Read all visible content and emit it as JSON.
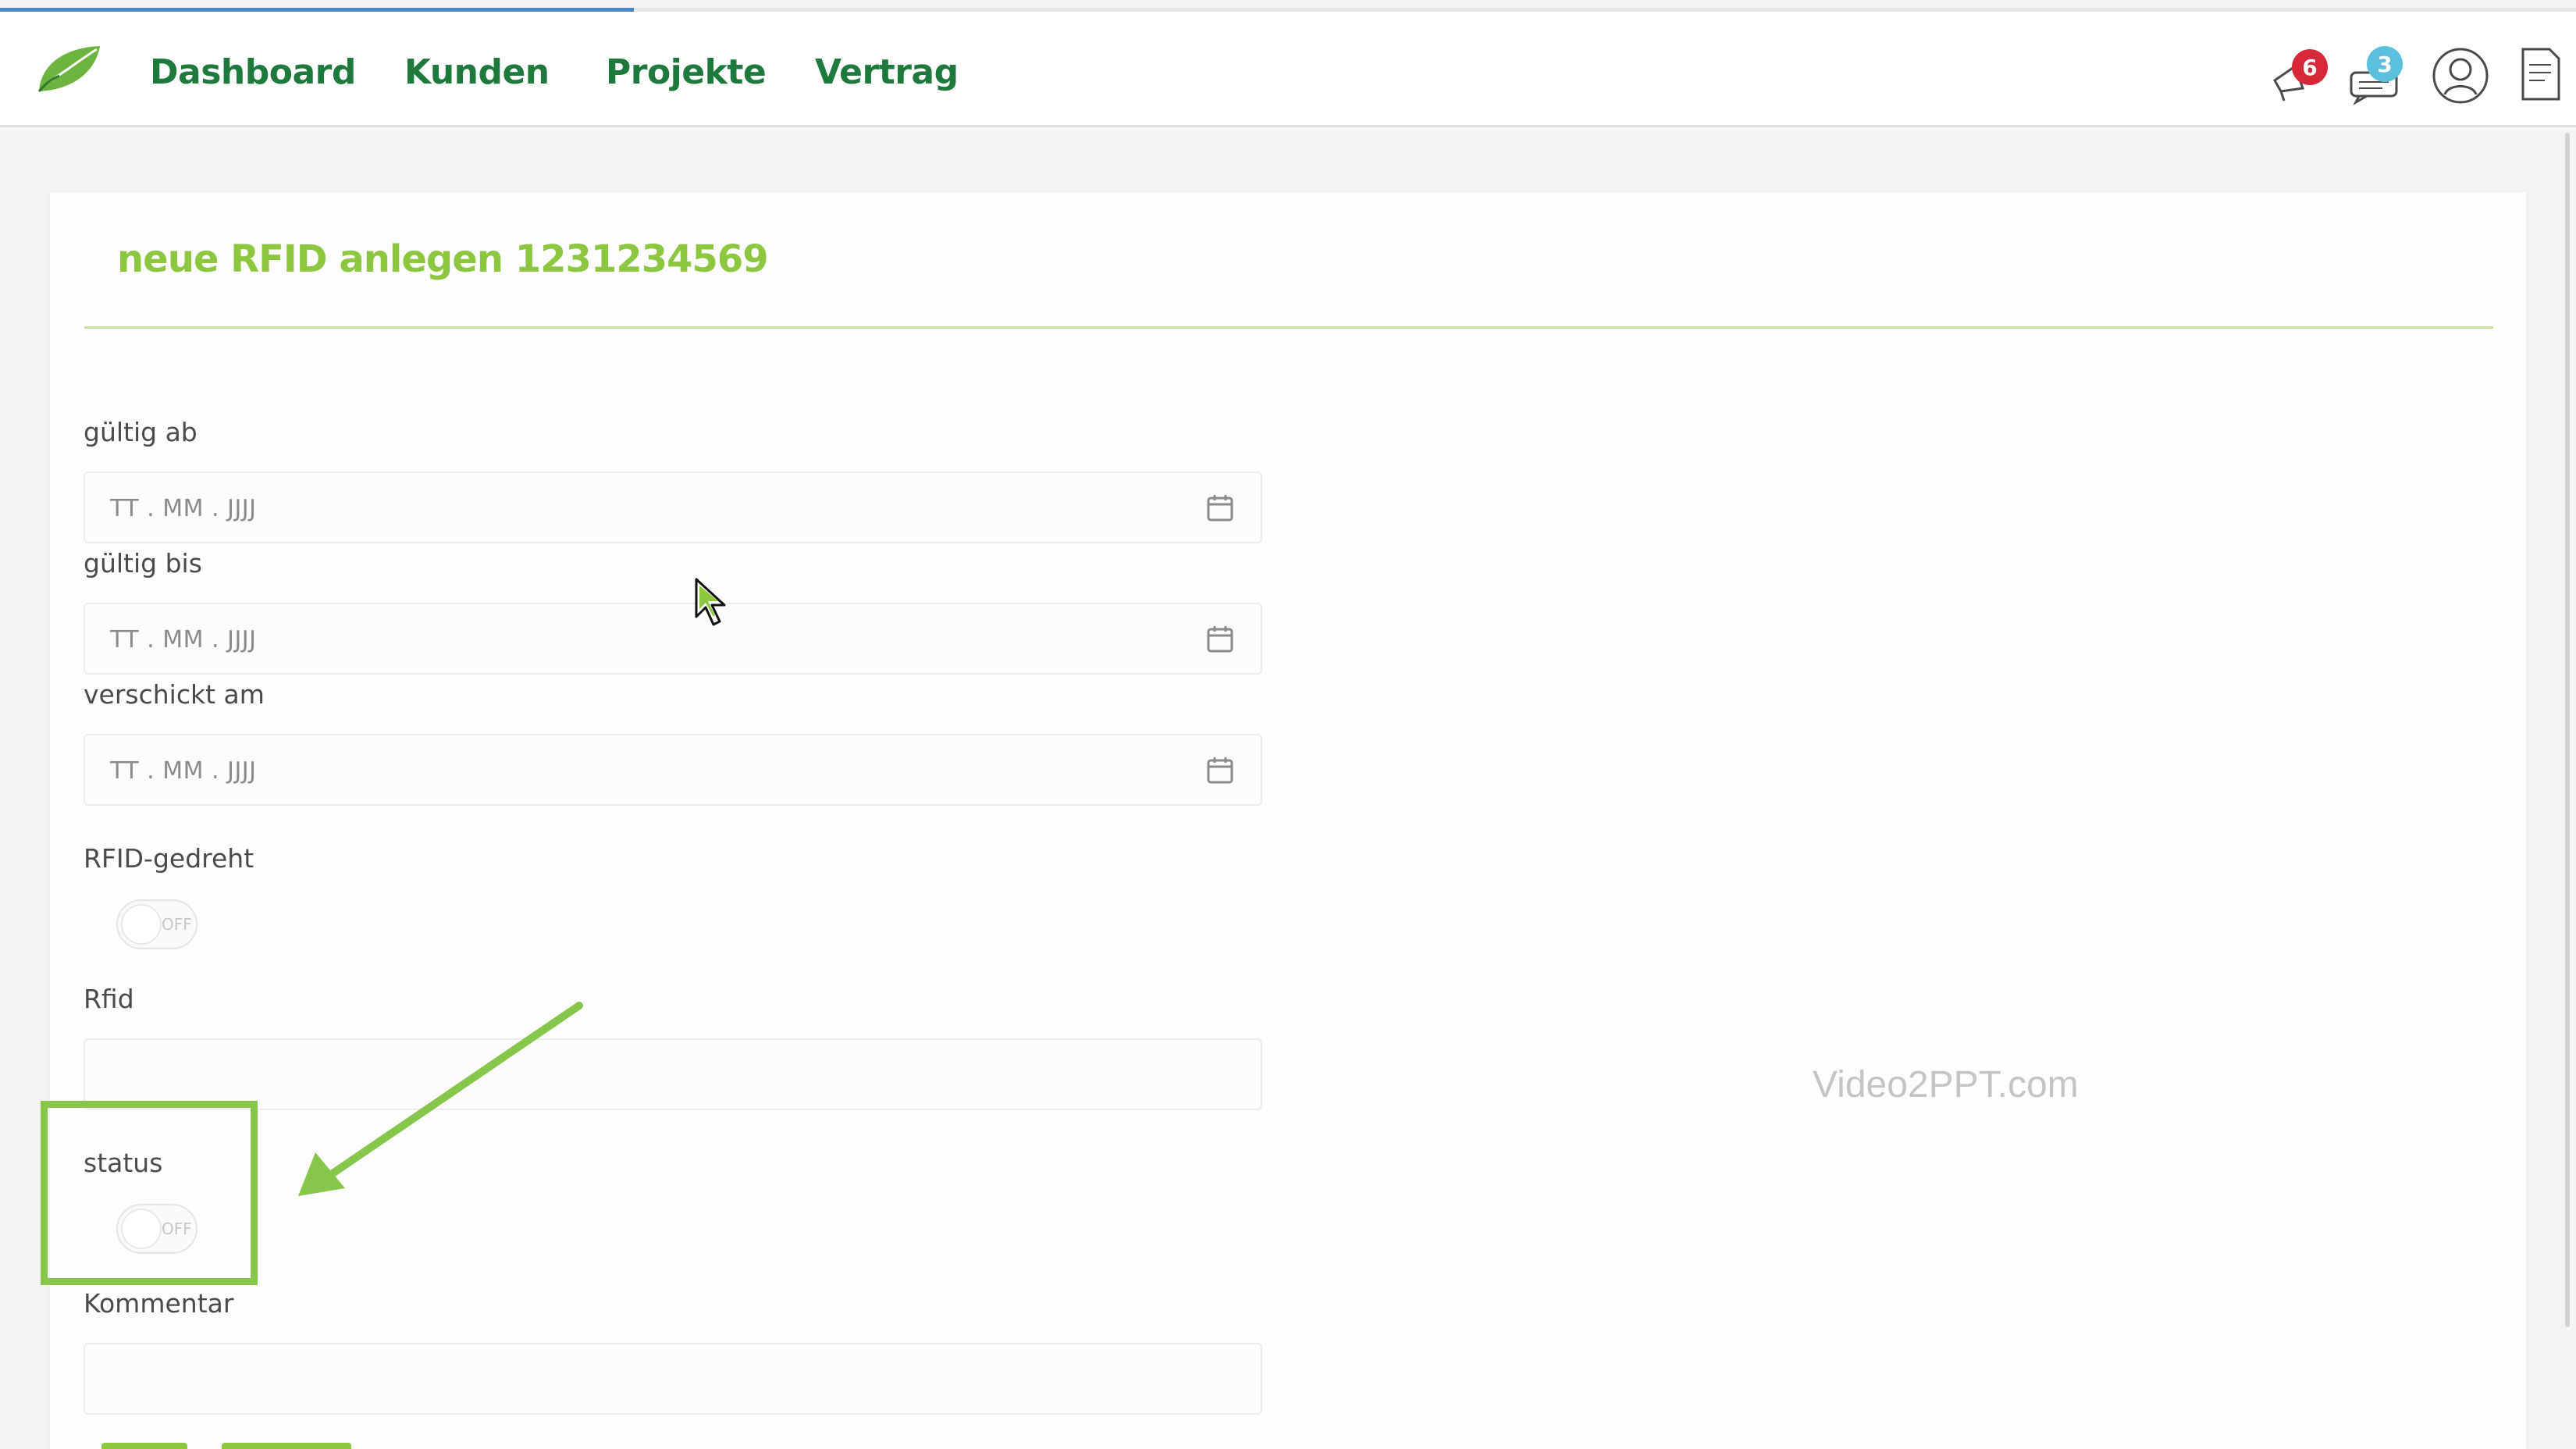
{
  "navbar": {
    "items": [
      {
        "label": "Dashboard"
      },
      {
        "label": "Kunden"
      },
      {
        "label": "Projekte"
      },
      {
        "label": "Vertrag"
      }
    ],
    "notifications": {
      "count": "6",
      "color": "#d62839"
    },
    "messages": {
      "count": "3",
      "color": "#5bc0de"
    },
    "progress_fraction": 0.246
  },
  "form": {
    "title": "neue RFID anlegen 1231234569",
    "fields": {
      "gueltig_ab": {
        "label": "gültig ab",
        "placeholder": "TT . MM . JJJJ"
      },
      "gueltig_bis": {
        "label": "gültig bis",
        "placeholder": "TT . MM . JJJJ"
      },
      "verschickt_am": {
        "label": "verschickt am",
        "placeholder": "TT . MM . JJJJ"
      },
      "rfid_gedreht": {
        "label": "RFID-gedreht",
        "state": "OFF"
      },
      "rfid": {
        "label": "Rfid",
        "value": ""
      },
      "status": {
        "label": "status",
        "state": "OFF"
      },
      "kommentar": {
        "label": "Kommentar",
        "value": ""
      }
    }
  },
  "watermark": "Video2PPT.com",
  "colors": {
    "accent": "#8dc63f",
    "nav_text": "#1e7a3c",
    "highlight": "#86c64a"
  }
}
